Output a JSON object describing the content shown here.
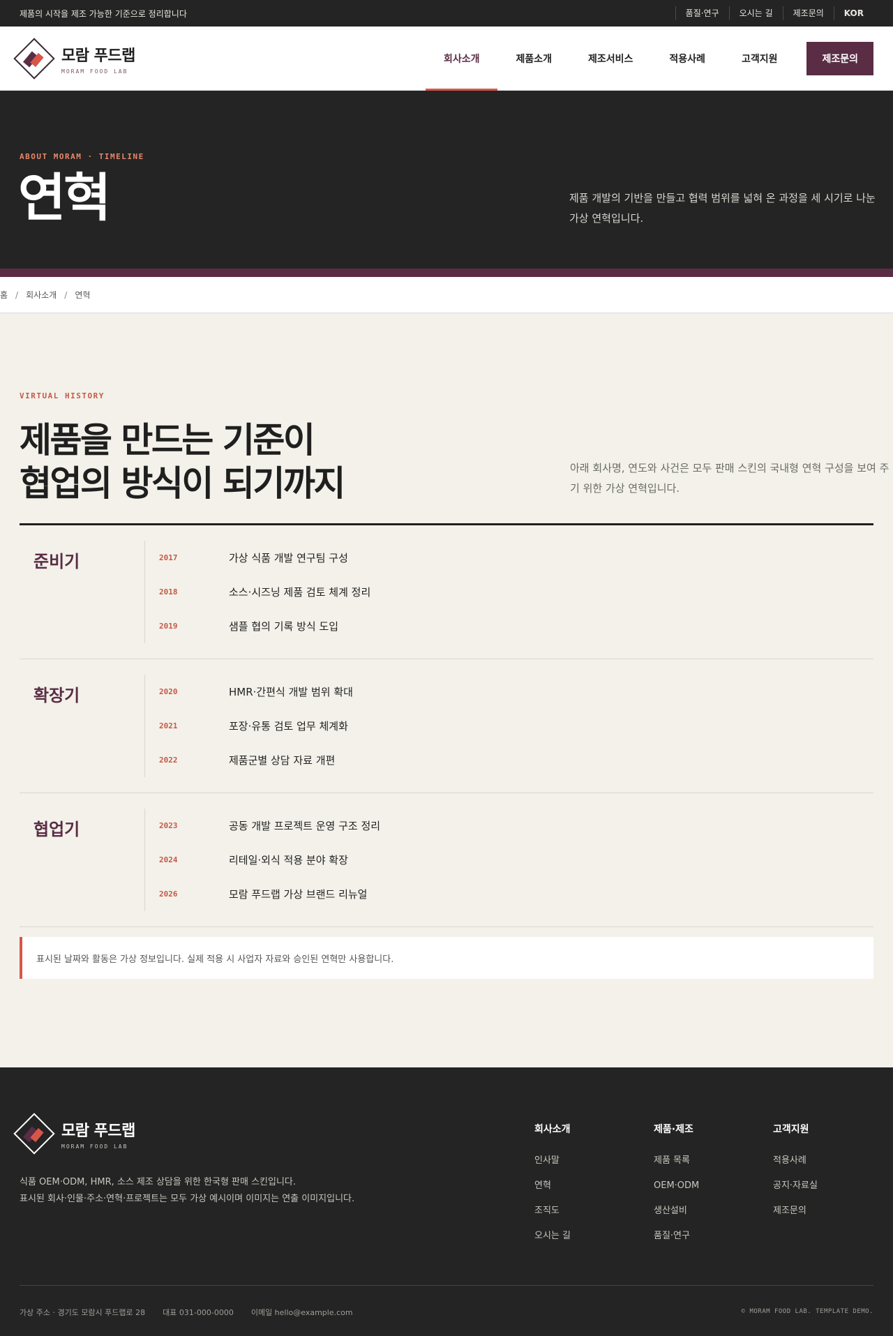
{
  "topbar": {
    "tagline": "제품의 시작을 제조 가능한 기준으로 정리합니다",
    "links": [
      "품질·연구",
      "오시는 길",
      "제조문의",
      "KOR"
    ]
  },
  "brand": {
    "name": "모람 푸드랩",
    "sub": "MORAM FOOD LAB"
  },
  "nav": {
    "items": [
      "회사소개",
      "제품소개",
      "제조서비스",
      "적용사례",
      "고객지원"
    ],
    "active": "회사소개",
    "cta": "제조문의"
  },
  "hero": {
    "eyebrow": "ABOUT MORAM · TIMELINE",
    "title": "연혁",
    "desc": "제품 개발의 기반을 만들고 협력 범위를 넓혀 온 과정을 세 시기로 나눈 가상 연혁입니다."
  },
  "breadcrumb": [
    "홈",
    "회사소개",
    "연혁"
  ],
  "history": {
    "eyebrow": "VIRTUAL HISTORY",
    "title_line1": "제품을 만드는 기준이",
    "title_line2": "협업의 방식이 되기까지",
    "lead": "아래 회사명, 연도와 사건은 모두 판매 스킨의 국내형 연혁 구성을 보여 주기 위한 가상 연혁입니다.",
    "periods": [
      {
        "name": "준비기",
        "events": [
          {
            "year": "2017",
            "text": "가상 식품 개발 연구팀 구성"
          },
          {
            "year": "2018",
            "text": "소스·시즈닝 제품 검토 체계 정리"
          },
          {
            "year": "2019",
            "text": "샘플 협의 기록 방식 도입"
          }
        ]
      },
      {
        "name": "확장기",
        "events": [
          {
            "year": "2020",
            "text": "HMR·간편식 개발 범위 확대"
          },
          {
            "year": "2021",
            "text": "포장·유통 검토 업무 체계화"
          },
          {
            "year": "2022",
            "text": "제품군별 상담 자료 개편"
          }
        ]
      },
      {
        "name": "협업기",
        "events": [
          {
            "year": "2023",
            "text": "공동 개발 프로젝트 운영 구조 정리"
          },
          {
            "year": "2024",
            "text": "리테일·외식 적용 분야 확장"
          },
          {
            "year": "2026",
            "text": "모람 푸드랩 가상 브랜드 리뉴얼"
          }
        ]
      }
    ],
    "notice": "표시된 날짜와 활동은 가상 정보입니다. 실제 적용 시 사업자 자료와 승인된 연혁만 사용합니다."
  },
  "footer": {
    "about_line1": "식품 OEM·ODM, HMR, 소스 제조 상담을 위한 한국형 판매 스킨입니다.",
    "about_line2": "표시된 회사·인물·주소·연혁·프로젝트는 모두 가상 예시이며 이미지는 연출 이미지입니다.",
    "columns": [
      {
        "title": "회사소개",
        "links": [
          "인사말",
          "연혁",
          "조직도",
          "오시는 길"
        ]
      },
      {
        "title": "제품·제조",
        "links": [
          "제품 목록",
          "OEM·ODM",
          "생산설비",
          "품질·연구"
        ]
      },
      {
        "title": "고객지원",
        "links": [
          "적용사례",
          "공지·자료실",
          "제조문의"
        ]
      }
    ],
    "address": "가상 주소 · 경기도 모람시 푸드랩로 28",
    "phone": "대표 031-000-0000",
    "email": "이메일 hello@example.com",
    "copyright": "© MORAM FOOD LAB. TEMPLATE DEMO."
  },
  "colors": {
    "accent": "#5a2d45",
    "highlight": "#d6564a",
    "dark": "#232423",
    "background": "#f3f1ea"
  }
}
